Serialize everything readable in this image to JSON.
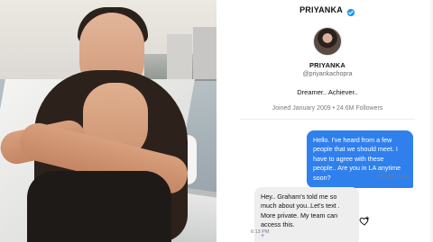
{
  "header": {
    "name": "PRIYANKA",
    "verified_icon": "verified-badge-icon",
    "accent_color": "#1d9bf0"
  },
  "profile": {
    "name": "PRIYANKA",
    "handle": "@priyankachopra",
    "bio": "Dreamer.. Achiever..",
    "meta": "Joined January 2009 • 24.6M Followers"
  },
  "messages": {
    "outgoing": {
      "text": "Hello. I've heard from a few people that we should meet. I have to agree with these people.. Are you in LA anytime soon?",
      "time": "5:57 PM · Sent",
      "bubble_color": "#2f80ed"
    },
    "incoming": {
      "text": "Hey.. Graham's told me so much about you..Let's text . More private. My team can access this.",
      "time": "6:13 PM",
      "extra_glyph": "+",
      "react_icon": "heart-add-icon",
      "bubble_color": "#eeeeee"
    }
  }
}
